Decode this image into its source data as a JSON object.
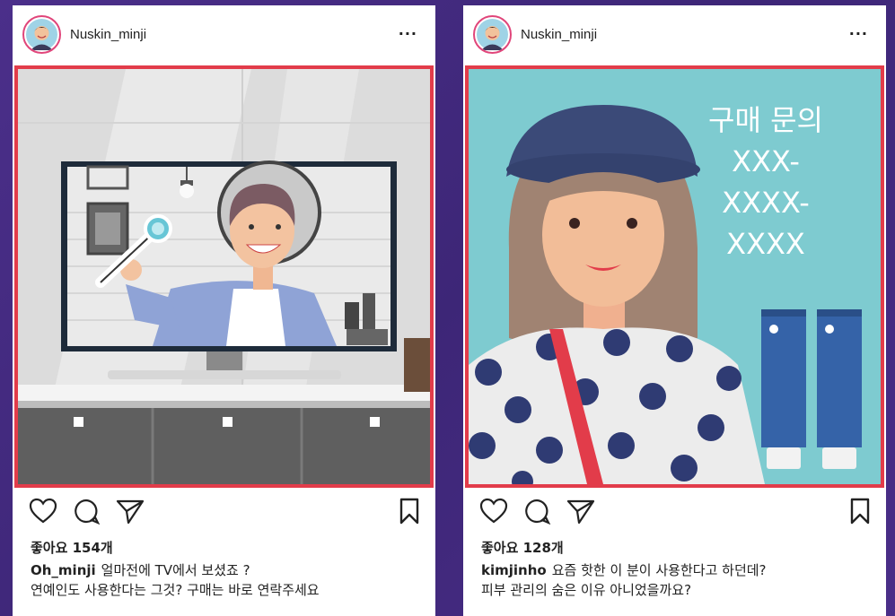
{
  "posts": [
    {
      "username": "Nuskin_minji",
      "more_label": "...",
      "likes": "좋아요 154개",
      "caption_user": "Oh_minji",
      "caption_line1": "얼마전에 TV에서 보셨죠 ?",
      "caption_line2": "연예인도 사용한다는 그것? 구매는 바로 연락주세요"
    },
    {
      "username": "Nuskin_minji",
      "more_label": "...",
      "likes": "좋아요 128개",
      "caption_user": "kimjinho",
      "caption_line1": "요즘 핫한 이 분이 사용한다고 하던데?",
      "caption_line2": "피부 관리의 숨은 이유 아니었을까요?",
      "overlay_lines": [
        "구매 문의",
        "XXX-",
        "XXXX-",
        "XXXX"
      ]
    }
  ],
  "icons": {
    "like": "heart-icon",
    "comment": "comment-icon",
    "share": "paper-plane-icon",
    "save": "bookmark-icon",
    "more": "more-icon"
  },
  "colors": {
    "background": "#4b2f8a",
    "media_border": "#e23c4a",
    "teal_background": "#7ecbd0"
  }
}
